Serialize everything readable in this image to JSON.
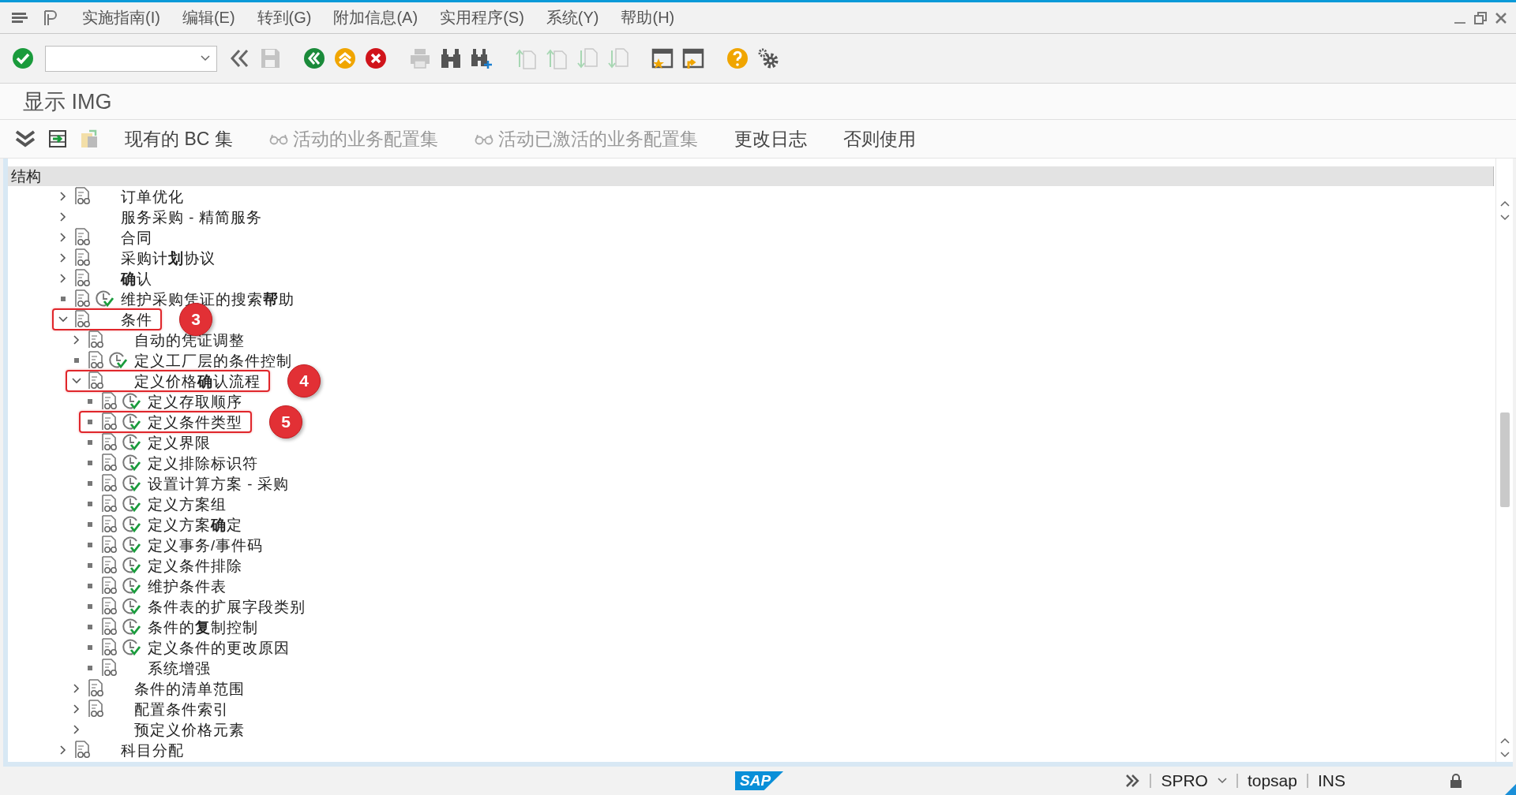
{
  "menu_bar": {
    "items": [
      "实施指南(I)",
      "编辑(E)",
      "转到(G)",
      "附加信息(A)",
      "实用程序(S)",
      "系统(Y)",
      "帮助(H)"
    ]
  },
  "toolbar": {
    "groups": [
      [
        {
          "kind": "enter",
          "disabled": false
        },
        {
          "kind": "command-field",
          "disabled": false
        },
        {
          "kind": "back-double",
          "disabled": false
        },
        {
          "kind": "save",
          "disabled": true
        }
      ],
      [
        {
          "kind": "back",
          "disabled": false
        },
        {
          "kind": "exit",
          "disabled": false
        },
        {
          "kind": "cancel",
          "disabled": false
        }
      ],
      [
        {
          "kind": "print",
          "disabled": true
        },
        {
          "kind": "find",
          "disabled": false
        },
        {
          "kind": "find-next",
          "disabled": false
        }
      ],
      [
        {
          "kind": "first-page",
          "disabled": true
        },
        {
          "kind": "prev-page",
          "disabled": true
        },
        {
          "kind": "next-page",
          "disabled": true
        },
        {
          "kind": "last-page",
          "disabled": true
        }
      ],
      [
        {
          "kind": "new-session",
          "disabled": false
        },
        {
          "kind": "shortcut",
          "disabled": false
        }
      ],
      [
        {
          "kind": "help",
          "disabled": false
        },
        {
          "kind": "settings",
          "disabled": false
        }
      ]
    ]
  },
  "title": "显示 IMG",
  "app_toolbar": [
    {
      "kind": "text",
      "label": "现有的 BC 集",
      "disabled": false
    },
    {
      "kind": "glasses-text",
      "label": "活动的业务配置集",
      "disabled": true
    },
    {
      "kind": "glasses-text",
      "label": "活动已激活的业务配置集",
      "disabled": true
    },
    {
      "kind": "text",
      "label": "更改日志",
      "disabled": false
    },
    {
      "kind": "text",
      "label": "否则使用",
      "disabled": false
    }
  ],
  "tree": {
    "header": "结构",
    "nodes": [
      {
        "label": "订单优化",
        "kind": "folder",
        "expanded": false,
        "doc": true,
        "executable": false
      },
      {
        "label": "服务采购 - 精简服务",
        "kind": "folder",
        "expanded": false,
        "doc": false,
        "executable": false
      },
      {
        "label": "合同",
        "kind": "folder",
        "expanded": false,
        "doc": true,
        "executable": false
      },
      {
        "label": "采购计**划**协议",
        "kind": "folder",
        "expanded": false,
        "doc": true,
        "executable": false
      },
      {
        "label": "**确**认",
        "kind": "folder",
        "expanded": false,
        "doc": true,
        "executable": false
      },
      {
        "label": "维护采购凭证的搜索**帮**助",
        "kind": "leaf",
        "doc": true,
        "executable": true
      },
      {
        "label": "条件",
        "kind": "folder",
        "expanded": true,
        "doc": true,
        "executable": false,
        "highlighted": true,
        "callout": "3",
        "children": [
          {
            "label": "自动的凭证调整",
            "kind": "folder",
            "expanded": false,
            "doc": true,
            "executable": false
          },
          {
            "label": "定义工厂层的条件控制",
            "kind": "leaf",
            "doc": true,
            "executable": true
          },
          {
            "label": "定义价格**确**认流程",
            "kind": "folder",
            "expanded": true,
            "doc": true,
            "executable": false,
            "highlighted": true,
            "callout": "4",
            "children": [
              {
                "label": "定义存取顺序",
                "kind": "leaf",
                "doc": true,
                "executable": true
              },
              {
                "label": "定义条件类型",
                "kind": "leaf",
                "doc": true,
                "executable": true,
                "highlighted": true,
                "callout": "5"
              },
              {
                "label": "定义界限",
                "kind": "leaf",
                "doc": true,
                "executable": true
              },
              {
                "label": "定义排除标识符",
                "kind": "leaf",
                "doc": true,
                "executable": true
              },
              {
                "label": "设置计算方案 - 采购",
                "kind": "leaf",
                "doc": true,
                "executable": true
              },
              {
                "label": "定义方案组",
                "kind": "leaf",
                "doc": true,
                "executable": true
              },
              {
                "label": "定义方案**确**定",
                "kind": "leaf",
                "doc": true,
                "executable": true
              },
              {
                "label": "定义事务/事件码",
                "kind": "leaf",
                "doc": true,
                "executable": true
              },
              {
                "label": "定义条件排除",
                "kind": "leaf",
                "doc": true,
                "executable": true
              },
              {
                "label": "维护条件表",
                "kind": "leaf",
                "doc": true,
                "executable": true
              },
              {
                "label": "条件表的扩展字段类别",
                "kind": "leaf",
                "doc": true,
                "executable": true
              },
              {
                "label": "条件的**复**制控制",
                "kind": "leaf",
                "doc": true,
                "executable": true
              },
              {
                "label": "定义条件的更改原因",
                "kind": "leaf",
                "doc": true,
                "executable": true
              },
              {
                "label": "系统增强",
                "kind": "leaf",
                "doc": true,
                "executable": false
              }
            ]
          },
          {
            "label": "条件的清单范围",
            "kind": "folder",
            "expanded": false,
            "doc": true,
            "executable": false
          },
          {
            "label": "配置条件索引",
            "kind": "folder",
            "expanded": false,
            "doc": true,
            "executable": false
          },
          {
            "label": "预定义价格元素",
            "kind": "folder",
            "expanded": false,
            "doc": false,
            "executable": false
          }
        ]
      },
      {
        "label": "科目分配",
        "kind": "folder",
        "expanded": false,
        "doc": true,
        "executable": false
      }
    ]
  },
  "status_bar": {
    "logo": "SAP",
    "transaction": "SPRO",
    "system": "topsap",
    "mode": "INS"
  }
}
